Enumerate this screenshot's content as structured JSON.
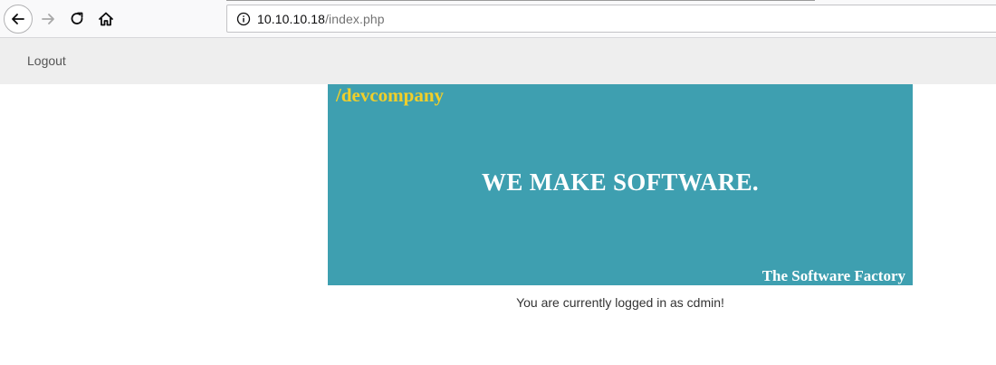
{
  "browser": {
    "url_host": "10.10.10.18",
    "url_path": "/index.php",
    "icons": {
      "back": "arrow-left-icon",
      "forward": "arrow-right-icon",
      "reload": "reload-icon",
      "home": "home-icon",
      "info": "info-icon"
    }
  },
  "navbar": {
    "logout_label": "Logout"
  },
  "banner": {
    "brand": "/devcompany",
    "headline": "WE MAKE SOFTWARE.",
    "tagline": "The Software Factory",
    "colors": {
      "background": "#3e9fb0",
      "brand": "#f1cf2a",
      "text": "#ffffff"
    }
  },
  "status": {
    "message": "You are currently logged in as cdmin!"
  }
}
